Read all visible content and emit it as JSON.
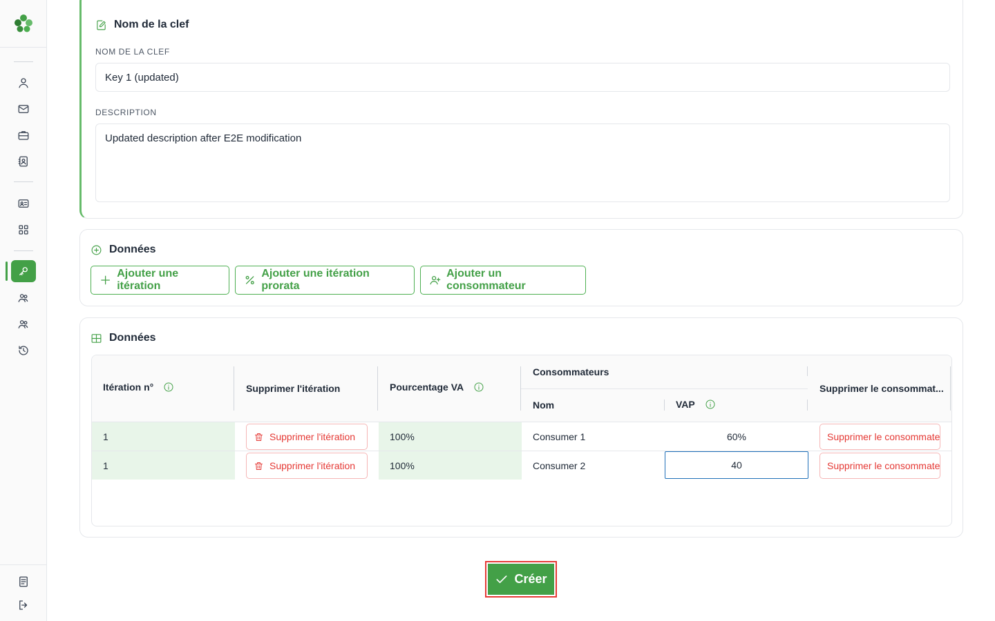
{
  "key_card": {
    "title": "Nom de la clef",
    "name_label": "NOM DE LA CLEF",
    "name_value": "Key 1 (updated)",
    "description_label": "DESCRIPTION",
    "description_value": "Updated description after E2E modification"
  },
  "actions_card": {
    "title": "Données",
    "add_iteration": "Ajouter une itération",
    "add_prorata_iteration": "Ajouter une itération prorata",
    "add_consumer": "Ajouter un consommateur"
  },
  "table_card": {
    "title": "Données",
    "headers": {
      "iteration": "Itération n°",
      "delete_iteration": "Supprimer l'itération",
      "percentage_va": "Pourcentage VA",
      "consumers": "Consommateurs",
      "name": "Nom",
      "vap": "VAP",
      "delete_consumer": "Supprimer le consommat..."
    },
    "rows": [
      {
        "iteration": "1",
        "delete_label": "Supprimer l'itération",
        "percentage": "100%",
        "name": "Consumer 1",
        "vap": "60%",
        "delete_consumer_label": "Supprimer le consommateur"
      },
      {
        "iteration": "1",
        "delete_label": "Supprimer l'itération",
        "percentage": "100%",
        "name": "Consumer 2",
        "vap": "40",
        "delete_consumer_label": "Supprimer le consommateur"
      }
    ]
  },
  "create_button": "Créer",
  "colors": {
    "accent": "#43a047",
    "danger": "#e53935",
    "focus": "#1e6fb8"
  }
}
